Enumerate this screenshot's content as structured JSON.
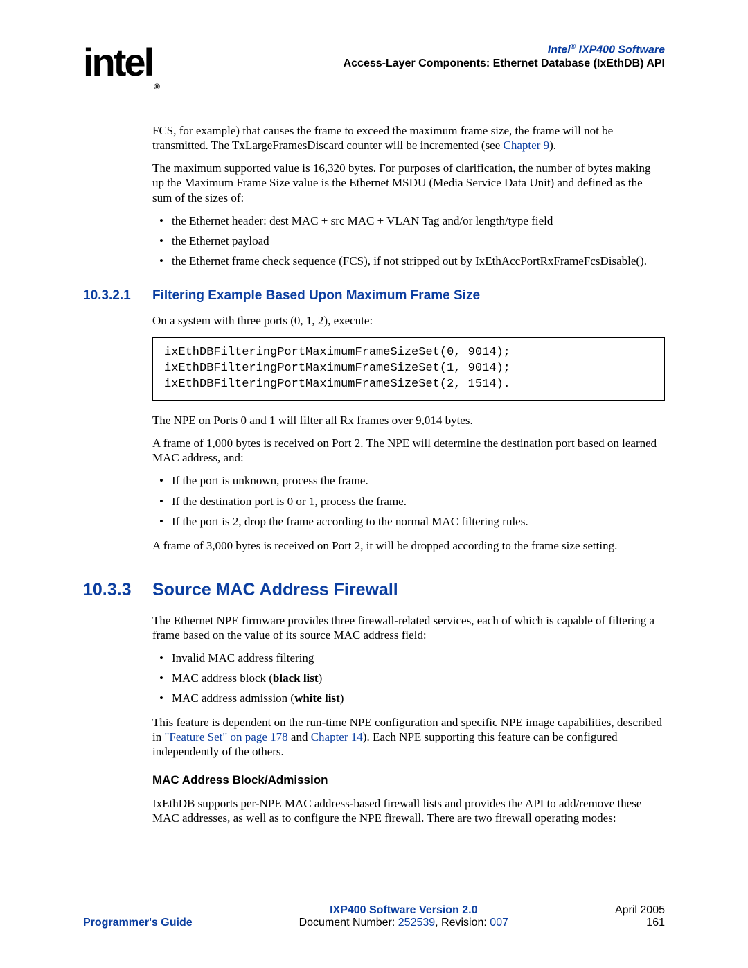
{
  "header": {
    "logo": "intel",
    "title_prefix": "Intel",
    "title_suffix": " IXP400 Software",
    "subtitle": "Access-Layer Components: Ethernet Database (IxEthDB) API"
  },
  "body": {
    "p1_a": "FCS, for example) that causes the frame to exceed the maximum frame size, the frame will not be transmitted. The TxLargeFramesDiscard counter will be incremented (see ",
    "p1_link": "Chapter 9",
    "p1_b": ").",
    "p2": "The maximum supported value is 16,320 bytes. For purposes of clarification, the number of bytes making up the Maximum Frame Size value is the Ethernet MSDU (Media Service Data Unit) and defined as the sum of the sizes of:",
    "list1": {
      "i0": "the Ethernet header: dest MAC + src MAC + VLAN Tag and/or length/type field",
      "i1": "the Ethernet payload",
      "i2": "the Ethernet frame check sequence (FCS), if not stripped out by IxEthAccPortRxFrameFcsDisable()."
    },
    "sec_h3_num": "10.3.2.1",
    "sec_h3_title": "Filtering Example Based Upon Maximum Frame Size",
    "p3": "On a system with three ports (0, 1, 2), execute:",
    "code": "ixEthDBFilteringPortMaximumFrameSizeSet(0, 9014);\nixEthDBFilteringPortMaximumFrameSizeSet(1, 9014);\nixEthDBFilteringPortMaximumFrameSizeSet(2, 1514).",
    "p4": "The NPE on Ports 0 and 1 will filter all Rx frames over 9,014 bytes.",
    "p5": "A frame of 1,000 bytes is received on Port 2. The NPE will determine the destination port based on learned MAC address, and:",
    "list2": {
      "i0": "If the port is unknown, process the frame.",
      "i1": "If the destination port is 0 or 1, process the frame.",
      "i2": "If the port is 2, drop the frame according to the normal MAC filtering rules."
    },
    "p6": "A frame of 3,000 bytes is received on Port 2, it will be dropped according to the frame size setting.",
    "sec_h2_num": "10.3.3",
    "sec_h2_title": "Source MAC Address Firewall",
    "p7": "The Ethernet NPE firmware provides three firewall-related services, each of which is capable of filtering a frame based on the value of its source MAC address field:",
    "list3": {
      "i0": "Invalid MAC address filtering",
      "i1a": "MAC address block (",
      "i1b": "black list",
      "i1c": ")",
      "i2a": "MAC address admission (",
      "i2b": "white list",
      "i2c": ")"
    },
    "p8_a": "This feature is dependent on the run-time NPE configuration and specific NPE image capabilities, described in ",
    "p8_link1": "\"Feature Set\" on page 178",
    "p8_mid": " and ",
    "p8_link2": "Chapter 14",
    "p8_b": "). Each NPE supporting this feature can be configured independently of the others.",
    "h4": "MAC Address Block/Admission",
    "p9": "IxEthDB supports per-NPE MAC address-based firewall lists and provides the API to add/remove these MAC addresses, as well as to configure the NPE firewall. There are two firewall operating modes:"
  },
  "footer": {
    "left": "Programmer's Guide",
    "center_top": "IXP400 Software Version 2.0",
    "center_bot_a": "Document Number: ",
    "center_bot_link1": "252539",
    "center_bot_mid": ", Revision: ",
    "center_bot_link2": "007",
    "right_top": "April 2005",
    "right_bot": "161"
  }
}
